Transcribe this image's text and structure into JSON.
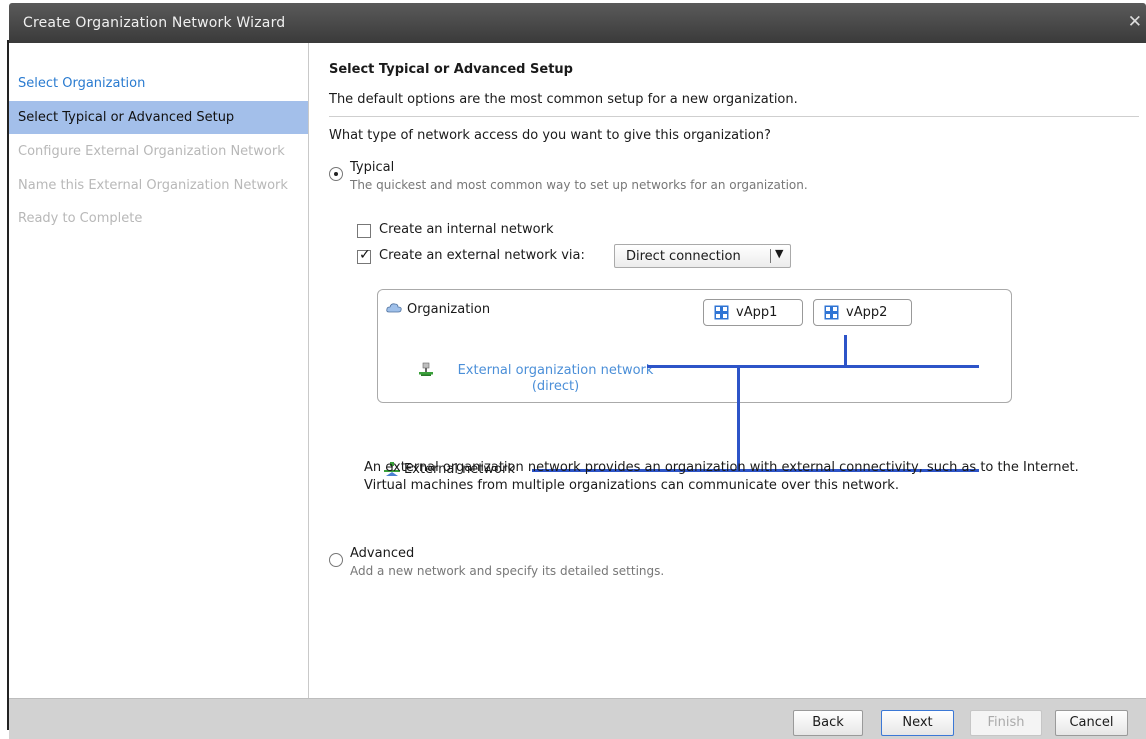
{
  "window": {
    "title": "Create Organization Network Wizard",
    "close_glyph": "✕"
  },
  "sidebar": {
    "steps": [
      {
        "label": "Select Organization",
        "state": "link"
      },
      {
        "label": "Select Typical or Advanced Setup",
        "state": "active"
      },
      {
        "label": "Configure External Organization Network",
        "state": "disabled"
      },
      {
        "label": "Name this External Organization Network",
        "state": "disabled"
      },
      {
        "label": "Ready to Complete",
        "state": "disabled"
      }
    ]
  },
  "content": {
    "heading": "Select Typical or Advanced Setup",
    "subheading": "The default options are the most common setup for a new organization.",
    "question": "What type of network access do you want to give this organization?",
    "typical": {
      "label": "Typical",
      "description": "The quickest and most common way to set up networks for an organization.",
      "selected": true
    },
    "internal_network": {
      "label": "Create an internal network",
      "checked": false
    },
    "external_network": {
      "label": "Create an external network via:",
      "checked": true
    },
    "connection_select": {
      "value": "Direct connection"
    },
    "diagram": {
      "organization": "Organization",
      "vapps": [
        "vApp1",
        "vApp2"
      ],
      "ext_org_network_line1": "External organization network",
      "ext_org_network_line2": "(direct)",
      "external_network": "External network"
    },
    "info": "An external organization network provides an organization with external connectivity, such as to the Internet. Virtual machines from multiple organizations can communicate over this network.",
    "advanced": {
      "label": "Advanced",
      "description": "Add a new network and specify its detailed settings.",
      "selected": false
    }
  },
  "footer": {
    "back": "Back",
    "next": "Next",
    "finish": "Finish",
    "cancel": "Cancel"
  },
  "colors": {
    "accent": "#a3bfea",
    "link": "#2a7bd0",
    "network_line": "#2d54c8"
  }
}
